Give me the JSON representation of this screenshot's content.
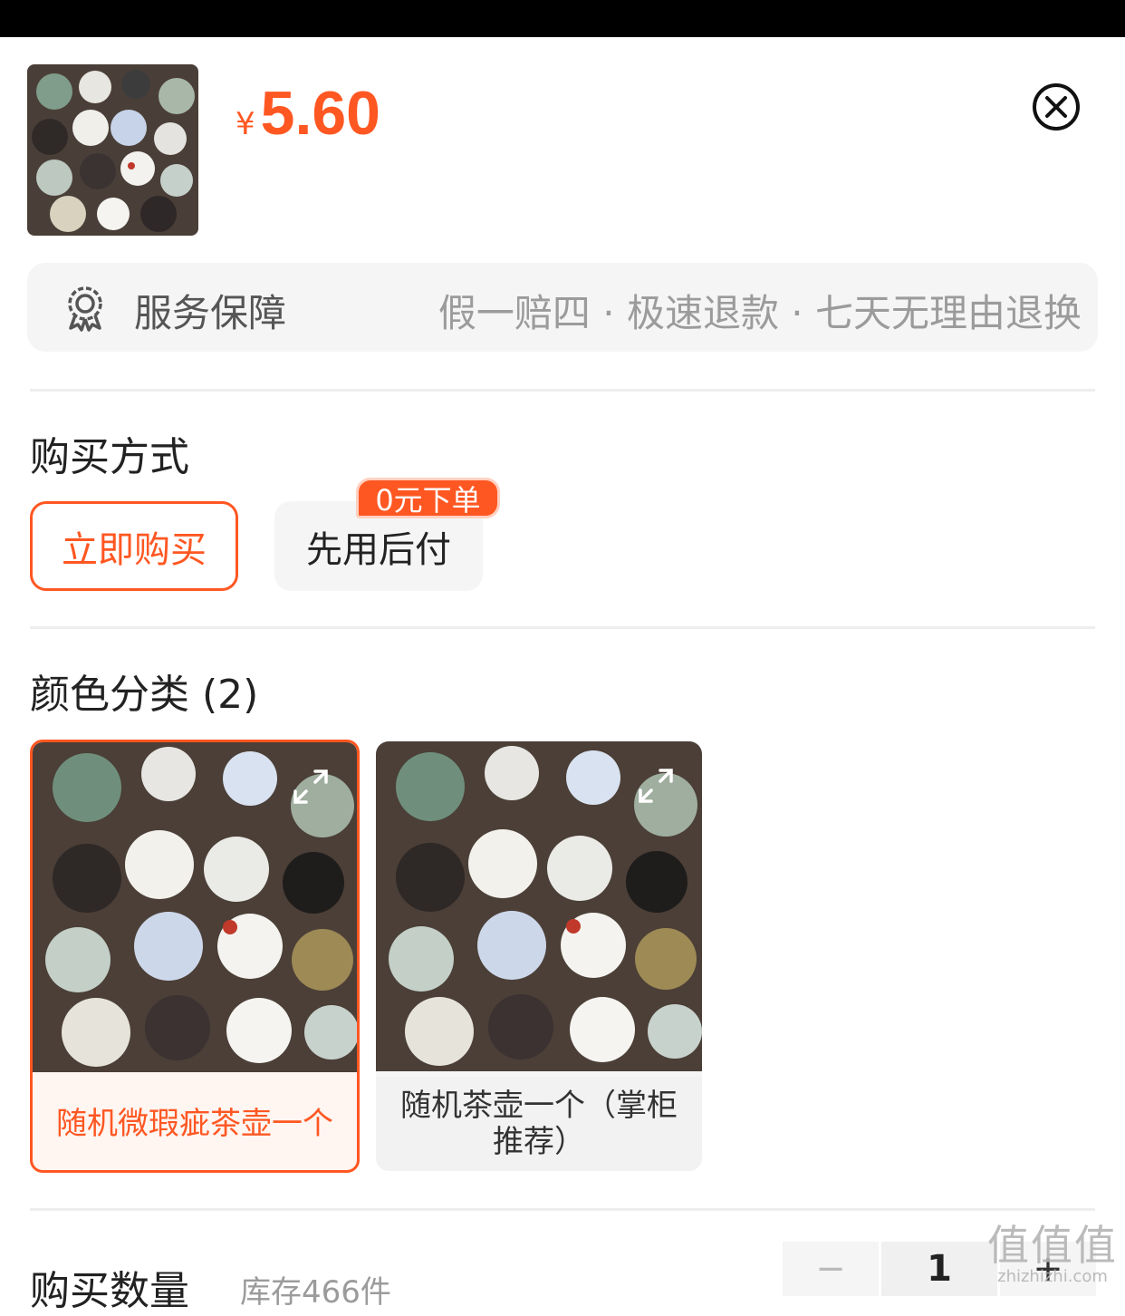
{
  "product": {
    "currency": "¥",
    "price": "5.60"
  },
  "service": {
    "label": "服务保障",
    "items": "假一赔四 · 极速退款 · 七天无理由退换"
  },
  "purchase": {
    "title": "购买方式",
    "options": [
      "立即购买",
      "先用后付"
    ],
    "badge": "0元下单"
  },
  "variants": {
    "title": "颜色分类 (2)",
    "items": [
      {
        "name": "随机微瑕疵茶壶一个",
        "selected": true
      },
      {
        "name": "随机茶壶一个（掌柜推荐）",
        "selected": false
      }
    ]
  },
  "quantity": {
    "title": "购买数量",
    "stock": "库存466件",
    "value": "1",
    "minus": "−",
    "plus": "+"
  },
  "watermark": {
    "big": "值值值",
    "small": "zhizhizhi.com"
  },
  "colors": {
    "accent": "#ff5722",
    "status_bar": "#000000"
  },
  "icons": {
    "close": "close-icon",
    "service": "shield-icon",
    "expand": "expand-icon"
  }
}
